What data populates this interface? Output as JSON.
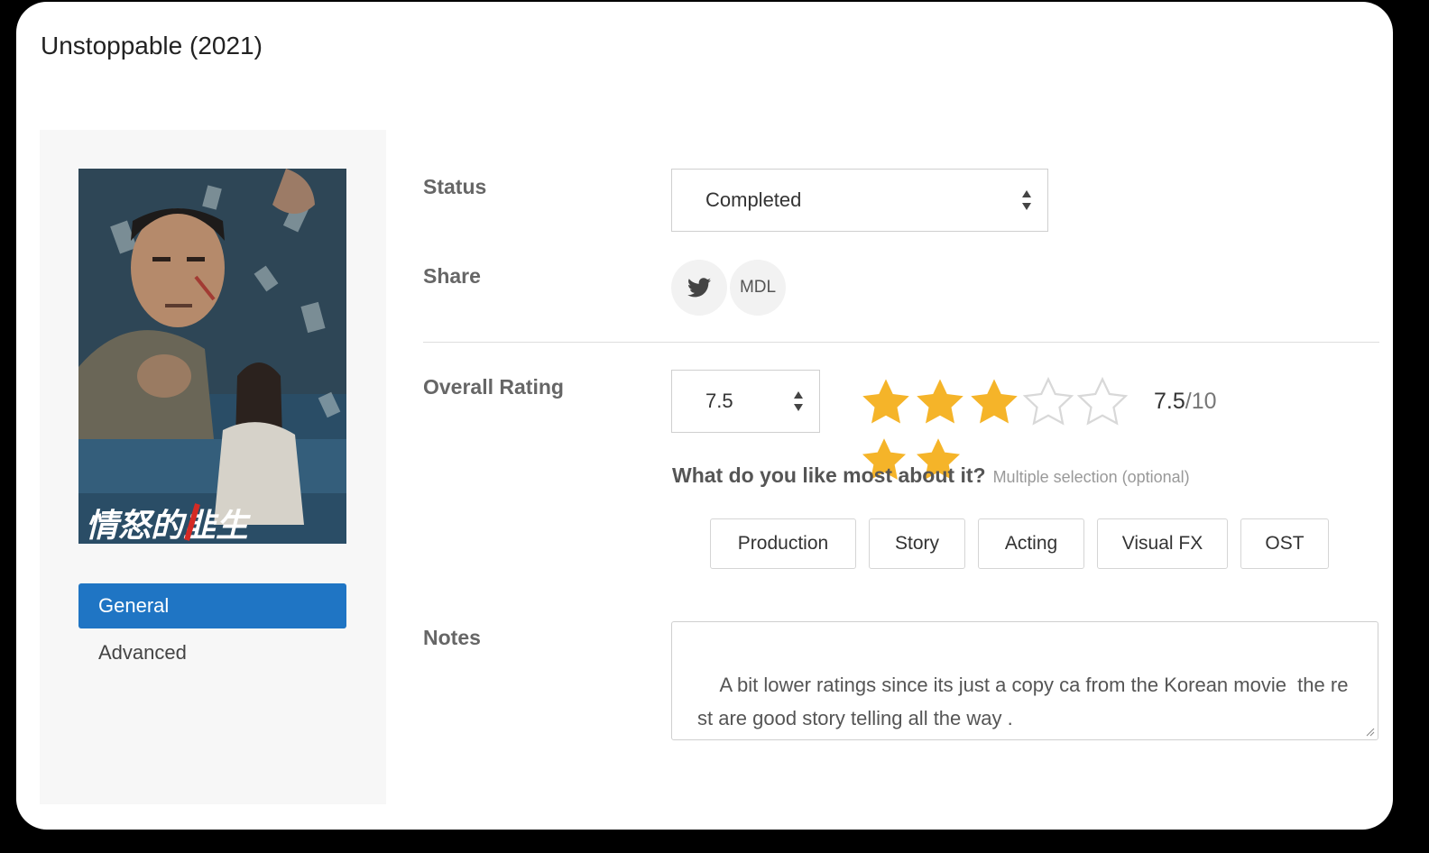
{
  "page": {
    "title": "Unstoppable (2021)"
  },
  "sidebar": {
    "poster_alt": "Unstoppable movie poster",
    "poster_text": "情怒的韭生",
    "items": [
      {
        "label": "General",
        "active": true
      },
      {
        "label": "Advanced",
        "active": false
      }
    ]
  },
  "form": {
    "status": {
      "label": "Status",
      "value": "Completed"
    },
    "share": {
      "label": "Share",
      "buttons": [
        {
          "icon": "twitter-icon"
        },
        {
          "label": "MDL"
        }
      ]
    },
    "overall_rating": {
      "label": "Overall Rating",
      "value": "7.5",
      "stars_filled": 3,
      "stars_total": 5,
      "display_value": "7.5",
      "display_max": "/10"
    },
    "likes": {
      "question": "What do you like most about it?",
      "hint": "Multiple selection (optional)",
      "options": [
        "Production",
        "Story",
        "Acting",
        "Visual FX",
        "OST"
      ]
    },
    "notes": {
      "label": "Notes",
      "value": "A bit lower ratings since its just a copy ca from the Korean movie  the rest are good story telling all the way ."
    }
  },
  "colors": {
    "accent": "#1f75c4",
    "star": "#f5b429"
  }
}
